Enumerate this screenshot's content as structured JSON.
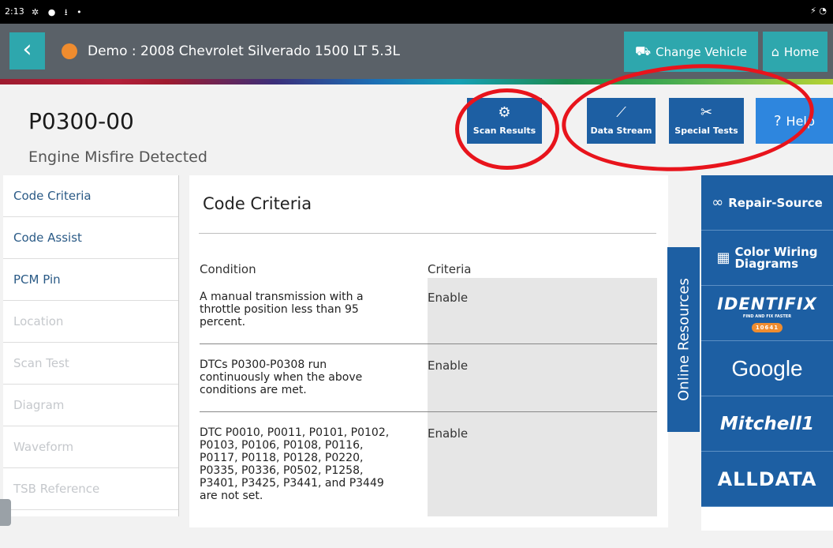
{
  "statusbar": {
    "time": "2:13",
    "icons": "✲ ● ⭳ •",
    "right_icons": "⚡ ◔"
  },
  "header": {
    "back_glyph": "‹",
    "vehicle": "Demo : 2008 Chevrolet Silverado 1500 LT 5.3L",
    "change_vehicle": "Change Vehicle",
    "home": "Home",
    "status_color": "#ef8c2f"
  },
  "dtc": {
    "code": "P0300-00",
    "description": "Engine Misfire Detected"
  },
  "toolbar": {
    "scan_results": "Scan Results",
    "data_stream": "Data Stream",
    "special_tests": "Special Tests",
    "help": "Help"
  },
  "nav": {
    "items": [
      {
        "label": "Code Criteria",
        "state": "active"
      },
      {
        "label": "Code Assist",
        "state": "active"
      },
      {
        "label": "PCM Pin",
        "state": "active"
      },
      {
        "label": "Location",
        "state": "disabled"
      },
      {
        "label": "Scan Test",
        "state": "disabled"
      },
      {
        "label": "Diagram",
        "state": "disabled"
      },
      {
        "label": "Waveform",
        "state": "disabled"
      },
      {
        "label": "TSB Reference",
        "state": "disabled"
      }
    ]
  },
  "criteria": {
    "title": "Code Criteria",
    "col_condition": "Condition",
    "col_criteria": "Criteria",
    "rows": [
      {
        "condition": "A manual transmission with a throttle position less than 95 percent.",
        "criteria": "Enable"
      },
      {
        "condition": "DTCs P0300-P0308 run continuously when the above conditions are met.",
        "criteria": "Enable"
      },
      {
        "condition": "DTC P0010, P0011, P0101, P0102, P0103, P0106, P0108, P0116, P0117, P0118, P0128, P0220, P0335, P0336, P0502, P1258, P3401, P3425, P3441, and P3449 are not set.",
        "criteria": "Enable"
      }
    ]
  },
  "resources": {
    "tab_label": "Online Resources",
    "repair_source": "Repair-Source",
    "color_wiring": "Color Wiring\nDiagrams",
    "identifix": "IDENTIFIX",
    "identifix_tagline": "FIND AND FIX FASTER",
    "identifix_badge": "10641",
    "google": "Google",
    "mitchell": "Mitchell1",
    "alldata": "ALLDATA"
  },
  "colors": {
    "accent_teal": "#2ea7ad",
    "brand_blue": "#1d5fa3",
    "annotation_red": "#e8141c"
  }
}
